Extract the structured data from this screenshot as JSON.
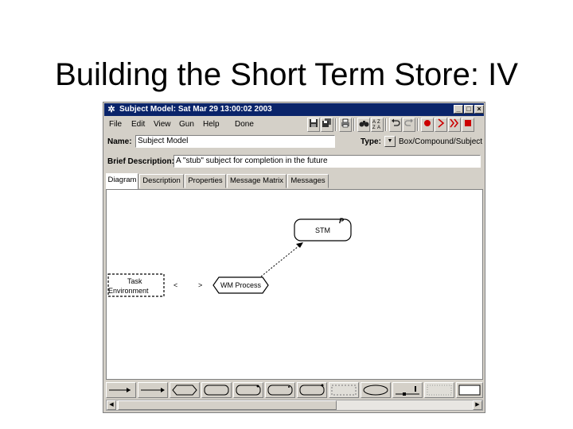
{
  "slide": {
    "title": "Building the Short Term Store: IV"
  },
  "window": {
    "title": "Subject Model: Sat Mar 29 13:00:02 2003",
    "controls": {
      "minimize": "_",
      "maximize": "□",
      "close": "×"
    }
  },
  "menu": {
    "file": "File",
    "edit": "Edit",
    "view": "View",
    "gun": "Gun",
    "help": "Help",
    "done": "Done"
  },
  "toolbar": {
    "icons": [
      "save-icon",
      "save-all-icon",
      "print-icon",
      "find-icon",
      "sort-icon",
      "undo-icon",
      "redo-icon",
      "record-icon",
      "play-icon",
      "fast-forward-icon",
      "stop-icon"
    ]
  },
  "form": {
    "name_label": "Name:",
    "name_value": "Subject Model",
    "type_label": "Type:",
    "type_value": "Box/Compound/Subject",
    "desc_label": "Brief Description:",
    "desc_value": "A \"stub\" subject for completion in the future"
  },
  "tabs": [
    "Diagram",
    "Description",
    "Properties",
    "Message Matrix",
    "Messages"
  ],
  "diagram": {
    "node_stm": "STM",
    "node_stm_badge": "P",
    "node_wm": "WM Process",
    "node_task_line1": "Task",
    "node_task_line2": "Environment",
    "arrow_in": "<",
    "arrow_out": ">"
  },
  "colors": {
    "titlebar": "#0a246a",
    "window_bg": "#d4d0c8",
    "record_red": "#cc0000"
  }
}
